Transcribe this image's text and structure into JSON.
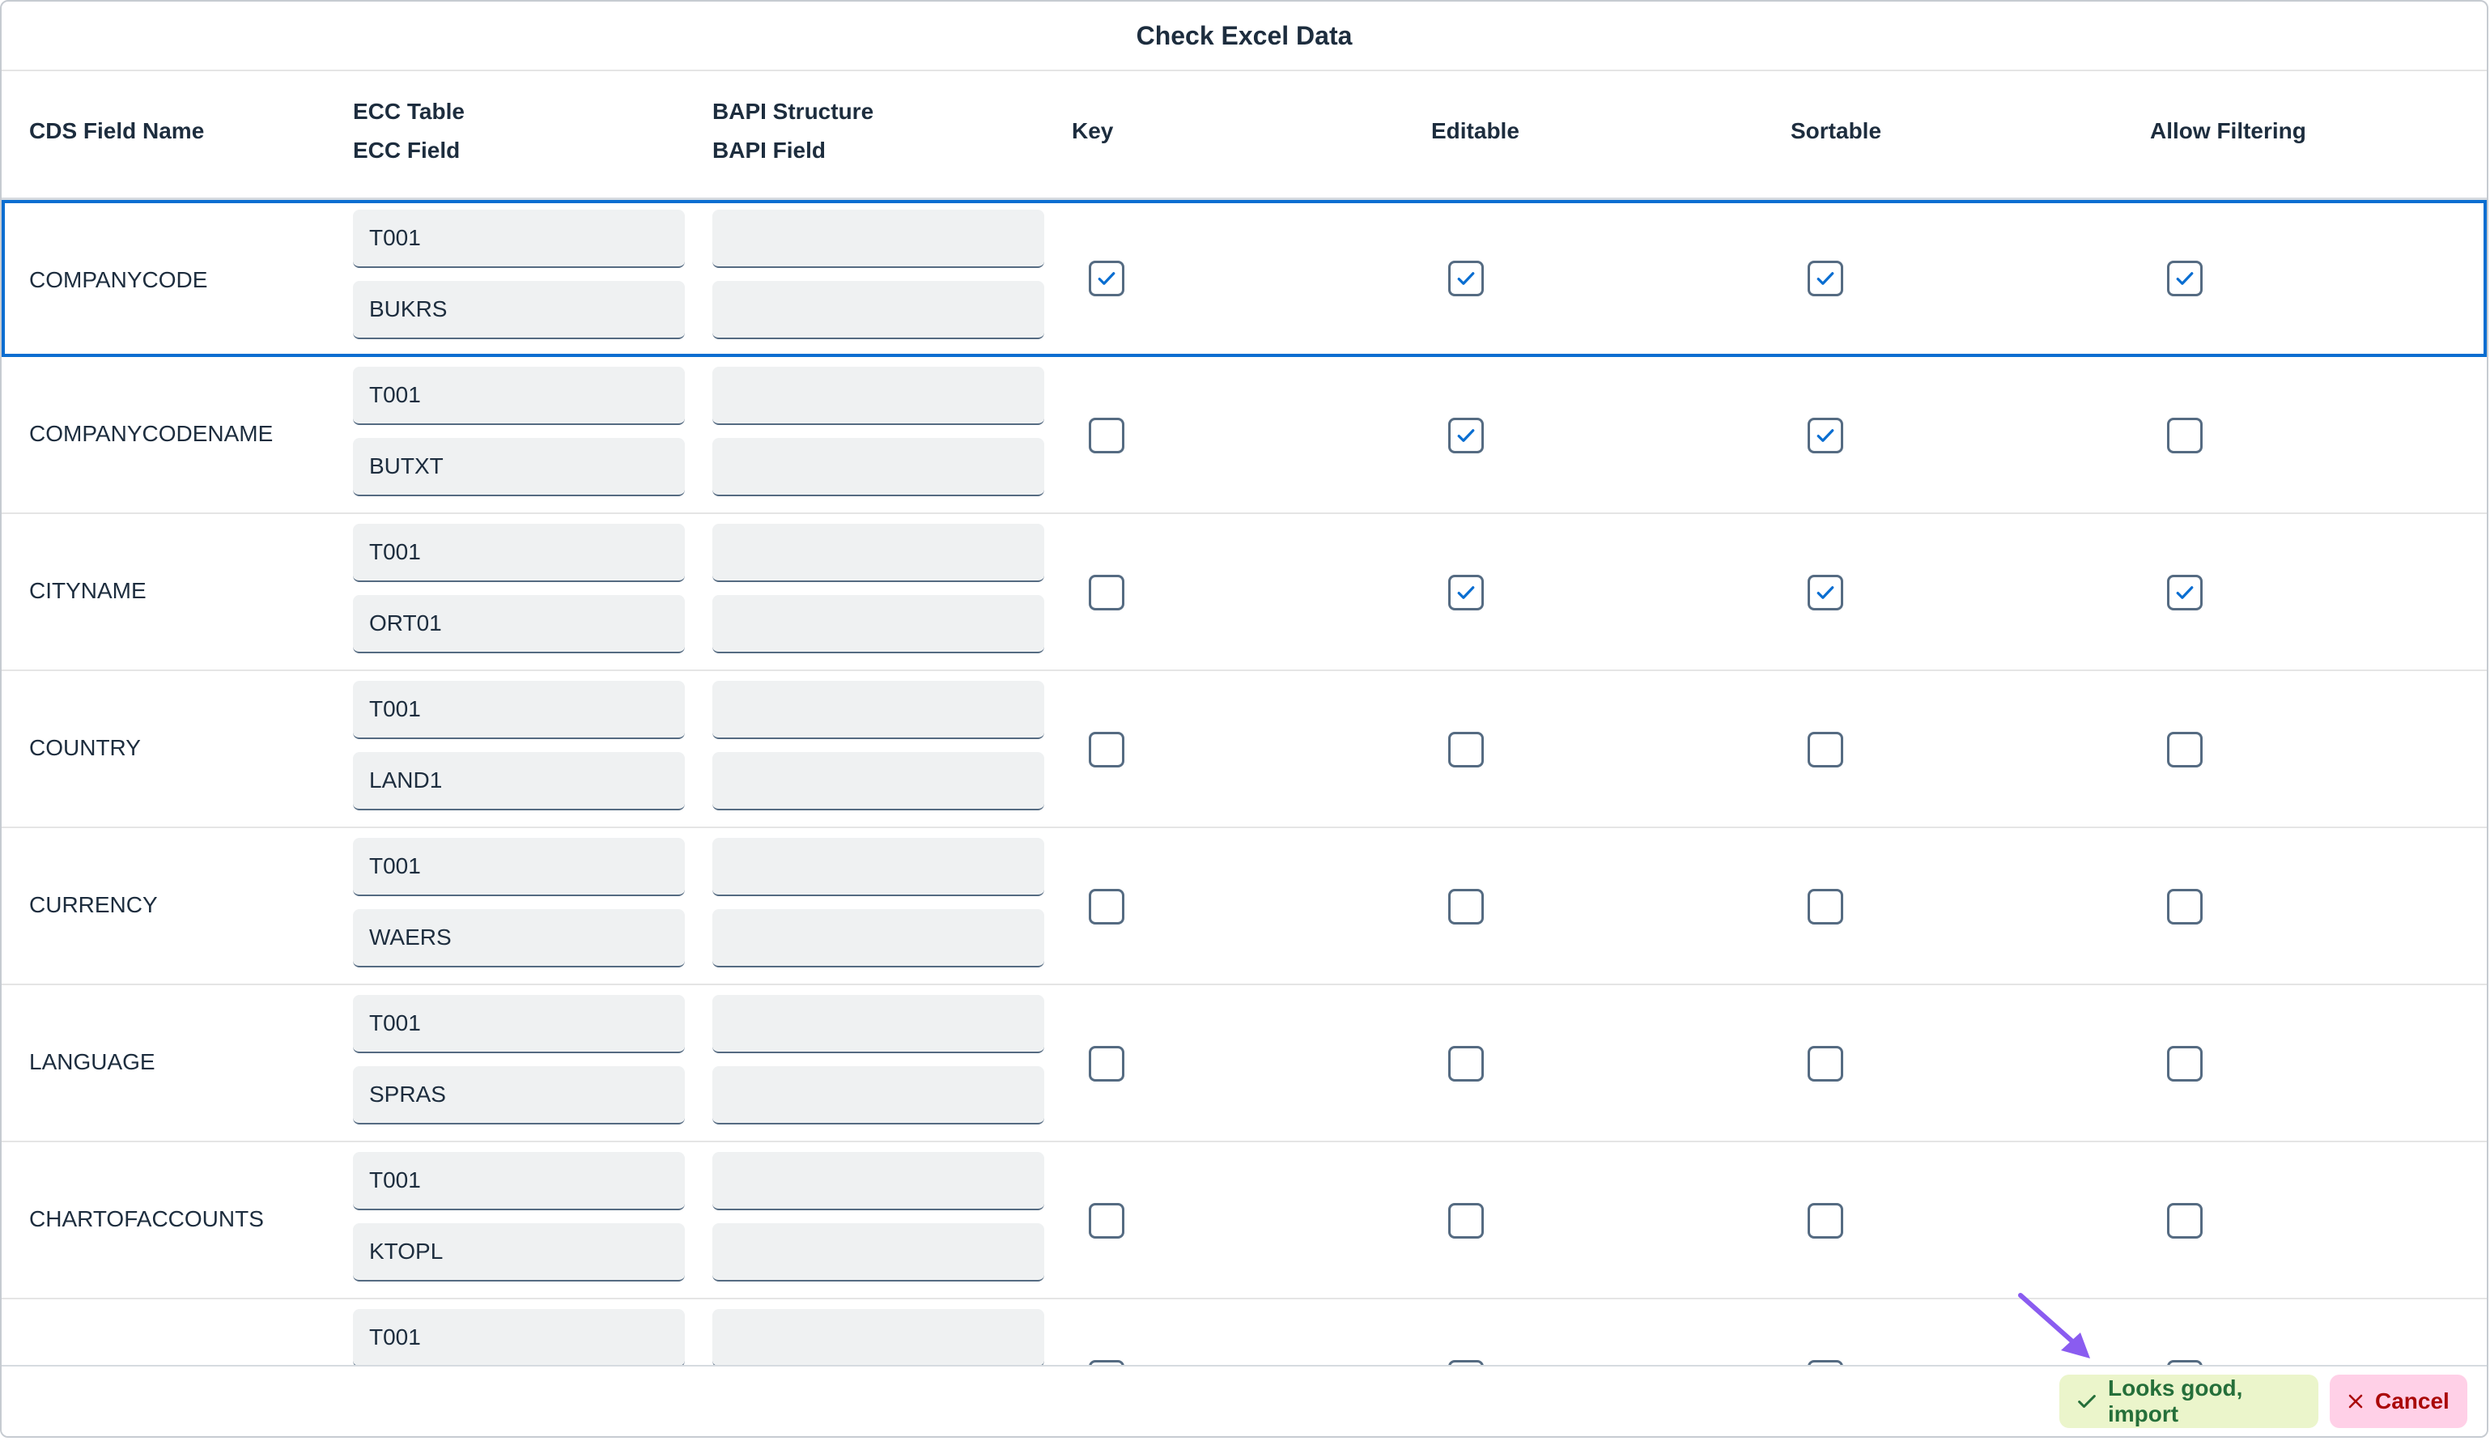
{
  "dialog": {
    "title": "Check Excel Data"
  },
  "table": {
    "headers": {
      "cds_field_name": "CDS Field Name",
      "ecc_table": "ECC Table",
      "ecc_field": "ECC Field",
      "bapi_structure": "BAPI Structure",
      "bapi_field": "BAPI Field",
      "key": "Key",
      "editable": "Editable",
      "sortable": "Sortable",
      "allow_filtering": "Allow Filtering"
    },
    "rows": [
      {
        "name": "COMPANYCODE",
        "ecc_table": "T001",
        "ecc_field": "BUKRS",
        "bapi_structure": "",
        "bapi_field": "",
        "key": true,
        "editable": true,
        "sortable": true,
        "filter": true,
        "selected": true
      },
      {
        "name": "COMPANYCODENAME",
        "ecc_table": "T001",
        "ecc_field": "BUTXT",
        "bapi_structure": "",
        "bapi_field": "",
        "key": false,
        "editable": true,
        "sortable": true,
        "filter": false
      },
      {
        "name": "CITYNAME",
        "ecc_table": "T001",
        "ecc_field": "ORT01",
        "bapi_structure": "",
        "bapi_field": "",
        "key": false,
        "editable": true,
        "sortable": true,
        "filter": true
      },
      {
        "name": "COUNTRY",
        "ecc_table": "T001",
        "ecc_field": "LAND1",
        "bapi_structure": "",
        "bapi_field": "",
        "key": false,
        "editable": false,
        "sortable": false,
        "filter": false
      },
      {
        "name": "CURRENCY",
        "ecc_table": "T001",
        "ecc_field": "WAERS",
        "bapi_structure": "",
        "bapi_field": "",
        "key": false,
        "editable": false,
        "sortable": false,
        "filter": false
      },
      {
        "name": "LANGUAGE",
        "ecc_table": "T001",
        "ecc_field": "SPRAS",
        "bapi_structure": "",
        "bapi_field": "",
        "key": false,
        "editable": false,
        "sortable": false,
        "filter": false
      },
      {
        "name": "CHARTOFACCOUNTS",
        "ecc_table": "T001",
        "ecc_field": "KTOPL",
        "bapi_structure": "",
        "bapi_field": "",
        "key": false,
        "editable": false,
        "sortable": false,
        "filter": false
      },
      {
        "name": "",
        "ecc_table": "T001",
        "ecc_field": "",
        "bapi_structure": "",
        "bapi_field": "",
        "key": false,
        "editable": false,
        "sortable": false,
        "filter": false
      }
    ]
  },
  "footer": {
    "accept_label": "Looks good, import",
    "cancel_label": "Cancel"
  },
  "icons": {
    "accept": "check-icon",
    "cancel": "close-icon",
    "annotation": "arrow-icon"
  },
  "colors": {
    "accent": "#0a6ed1",
    "accept_bg": "#ebf5cb",
    "accept_text": "#256f3a",
    "cancel_bg": "#ffd0e7",
    "cancel_text": "#aa0808",
    "annotation_arrow": "#8a5cf0"
  }
}
